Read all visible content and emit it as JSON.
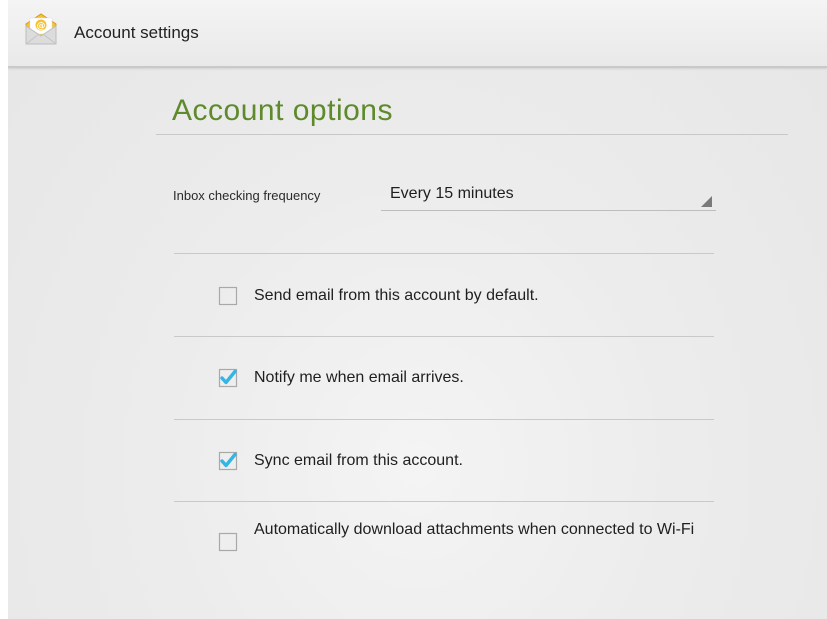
{
  "action_bar": {
    "app_icon": "email-envelope-icon",
    "title": "Account settings"
  },
  "section": {
    "title": "Account options"
  },
  "inbox_frequency": {
    "label": "Inbox checking frequency",
    "value": "Every 15 minutes",
    "arrow_icon": "spinner-corner-arrow-icon"
  },
  "options": [
    {
      "label": "Send email from this account by default.",
      "checked": false
    },
    {
      "label": "Notify me when email arrives.",
      "checked": true
    },
    {
      "label": "Sync email from this account.",
      "checked": true
    },
    {
      "label": "Automatically download attachments when connected to Wi-Fi",
      "checked": false
    }
  ],
  "colors": {
    "section_title": "#5e8a2c",
    "checkmark": "#33b5e5",
    "app_icon_envelope": "#f6c232"
  }
}
